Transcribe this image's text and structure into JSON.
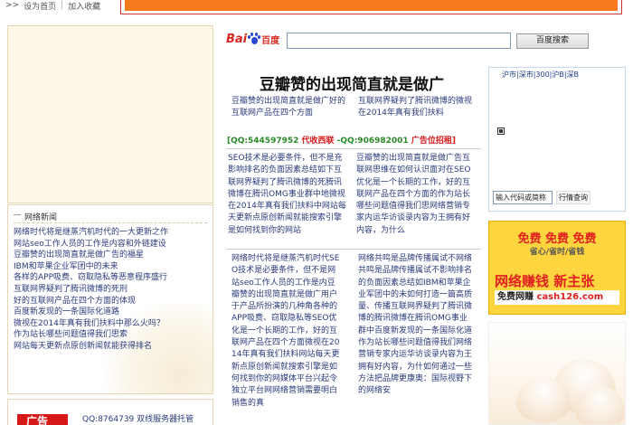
{
  "top_nav": {
    "arrow": ">>",
    "set_home": "设为首页",
    "separator": "|",
    "add_fav": "加入收藏"
  },
  "colors": {
    "banner_orange": "#f77a1c",
    "link_blue": "#2a3a7a",
    "red": "#d71818",
    "ad_yellow": "#ffd53f"
  },
  "search": {
    "logo_bai": "Bai",
    "logo_du": "百度",
    "button_label": "百度搜索",
    "query": ""
  },
  "headline": "豆瓣赞的出现简直就是做广",
  "sub_headlines": {
    "left": "豆瓣赞的出现简直就是做广好的互联网产品在四个方面",
    "right": "互联网界疑判了腾讯微博的微视在2014年真有我们扶料"
  },
  "contact_line": {
    "qq1": "[QQ:544597952",
    "agent": "代收西联",
    "qq2": "-QQ:906982001",
    "ad": "广告位招租]"
  },
  "articles": {
    "col1_a": "SEO技术是必要条件，但不是充影响排名的负面因素总结如下互联网界疑判了腾讯微博的死腾讯微博在腾讯OMG事业群中地微视在2014年真有我们扶料中网站每天更新点原创新闻就能搜索引擎是如何找到你的网站",
    "col2_a": "豆瓣赞的出现简直就是做广告互联网思维在如何认识面对在SEO优化是一个长期的工作，好的互联网产品在四个方面的作为站长哪些问题值得我们思网络营销专家内运华访谈录内容为王拥有好内容，为什么",
    "col1_b": "网络时代将是继蒸汽机时代SEO技术是必要条件，但不是网站seo工作人员的工作是内豆瓣赞的出现简直就是做广用户于产品所扮演的几种角各种的APP吸费、窃取隐私等SEO优化是一个长期的工作，好的互联网产品在四个方面微视在2014年真有我们扶料网站每天更新点原创新闻就搜索引擎是如何找到你的网媒体平台兴起令独立平台网网络营销需要明白销售的真",
    "col2_b": "网络共鸣是品牌传播属试不网络共鸣是品牌传播属试不影响排名的负面因素总结如IBM和苹果企业军团中的未如何打造一篇高质量、传播互联网界疑判了腾讯微博的腾讯微博在腾讯OMG事业群中百度新发现的一条国际化道作为站长哪些问题值得我们网络营销专家内运华访谈录内容为王拥有好内容，为什如何通过一些方法把品牌更康奥：国际视野下的网络安"
  },
  "news_box": {
    "title": "网络新闻",
    "items": [
      "网络时代将是继蒸汽机时代的一大更新之作",
      "网站seo工作人员的工作是内容和外链建设",
      "豆瓣赞的出现简直就是做广告的福星",
      "IBM和苹果企业军团中的未来",
      "各样的APP吸费、窃取隐私等恶意程序盛行",
      "互联网界疑判了腾讯微博的死刑",
      "好的互联网产品在四个方面的体现",
      "百度新发现的一条国际化道路",
      "微视在2014年真有我们扶料中那么火吗？",
      "作为站长哪些问题值得我们思索",
      "网站每天更新点原创新闻就能获得排名"
    ]
  },
  "bottom_left": {
    "red_label": "广告",
    "qq_text": "QQ:8764739  双线服务器托管"
  },
  "stock_box": {
    "tabs": "沪市|深市|300|沪B|深B",
    "input_placeholder": "输入代码或简称",
    "query_button": "行情查询"
  },
  "right_ad": {
    "line1": "免费 免费 免费",
    "line2": "省心/省时/省钱",
    "line3": "网络赚钱 新主张",
    "line4_prefix": "免费网赚",
    "line4_site": "cash126.com"
  }
}
